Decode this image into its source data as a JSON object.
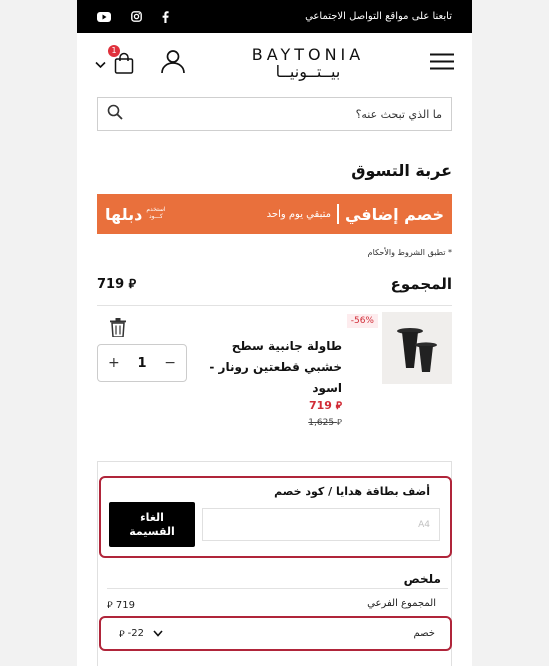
{
  "topbar": {
    "follow_text": "تابعنا على مواقع التواصل الاجتماعي"
  },
  "header": {
    "logo_en": "BAYTONIA",
    "logo_ar": "بيــتــونيــا",
    "cart_count": "1"
  },
  "search": {
    "placeholder": "ما الذي تبحث عنه؟"
  },
  "page": {
    "title": "عربة التسوق"
  },
  "banner": {
    "main": "خصم إضافي",
    "sub": "متبقي يوم واحد",
    "code_label_line1": "استخدم",
    "code_label_line2": "كـــود",
    "code": "دبلها"
  },
  "terms": "* تطبق الشروط والأحكام",
  "total": {
    "label": "المجموع",
    "value": "719"
  },
  "cart_item": {
    "discount": "56%-",
    "name": "طاولة جانبية سطح خشبي قطعتين رونار - اسود",
    "price": "719",
    "old_price": "1,625",
    "quantity": "1",
    "minus": "−",
    "plus": "+"
  },
  "coupon": {
    "label": "أضف بطاقة هدايا / كود خصم",
    "input_value": "A4",
    "cancel_button": "الغاء\nالقسيمة"
  },
  "summary": {
    "title": "ملخص",
    "subtotal_label": "المجموع الفرعي",
    "subtotal_value": "719",
    "discount_label": "خصم",
    "discount_value": "-22"
  },
  "colors": {
    "banner": "#e9703c",
    "highlight_border": "#b0253a",
    "sale_red": "#d12b36",
    "badge": "#e0313c"
  }
}
